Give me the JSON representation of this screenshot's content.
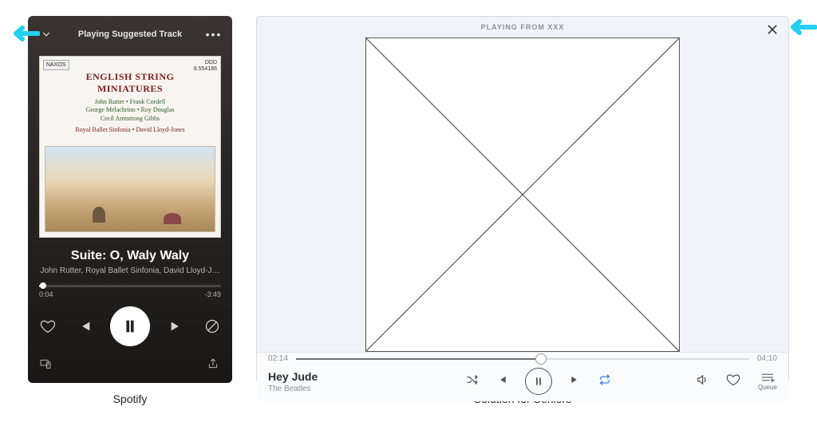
{
  "annotation": {
    "arrow_color": "#24d0f0"
  },
  "spotify": {
    "header_label": "Playing Suggested Track",
    "album": {
      "publisher": "NAXOS",
      "catalog_format": "DDD",
      "catalog_number": "8.554186",
      "title_line1": "ENGLISH STRING",
      "title_line2": "MINIATURES",
      "composers": "John Rutter • Frank Cordell\nGeorge Melachrino • Roy Douglas\nCecil Armstrong Gibbs",
      "performers": "Royal Ballet Sinfonia • David Lloyd-Jones"
    },
    "track_title": "Suite: O, Waly Waly",
    "artist_line": "John Rutter, Royal Ballet Sinfonia, David Lloyd-J…",
    "elapsed": "0:04",
    "remaining": "-3:49"
  },
  "seniors": {
    "header_label": "PLAYING FROM XXX",
    "track_title": "Hey Jude",
    "artist": "The Beatles",
    "elapsed": "02:14",
    "duration": "04:10",
    "queue_label": "Queue"
  },
  "captions": {
    "left": "Spotify",
    "right": "Solution for Seniors"
  }
}
